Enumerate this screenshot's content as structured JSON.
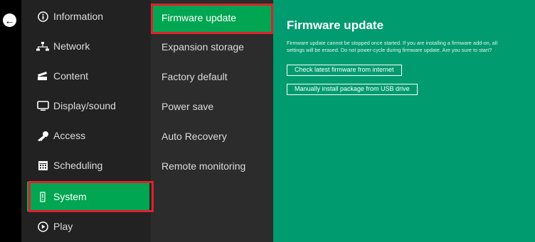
{
  "back_button": {
    "label": "back",
    "icon": "arrow-left-circle-icon"
  },
  "menu": {
    "items": [
      {
        "label": "Information",
        "icon": "info-icon"
      },
      {
        "label": "Network",
        "icon": "network-icon"
      },
      {
        "label": "Content",
        "icon": "content-icon"
      },
      {
        "label": "Display/sound",
        "icon": "display-icon"
      },
      {
        "label": "Access",
        "icon": "key-icon"
      },
      {
        "label": "Scheduling",
        "icon": "calendar-icon"
      },
      {
        "label": "System",
        "icon": "system-icon",
        "selected": true
      },
      {
        "label": "Play",
        "icon": "play-icon"
      }
    ]
  },
  "submenu": {
    "items": [
      {
        "label": "Firmware update",
        "selected": true
      },
      {
        "label": "Expansion storage"
      },
      {
        "label": "Factory default"
      },
      {
        "label": "Power save"
      },
      {
        "label": "Auto Recovery"
      },
      {
        "label": "Remote monitoring"
      }
    ]
  },
  "panel": {
    "title": "Firmware update",
    "description_line1": "Firmware update cannot be stopped once started. If you are installing a firmware add-on, all",
    "description_line2": "settings will be erased. Do not power-cycle during firmware update. Are you sure to start?",
    "check_button": "Check latest firmware from internet",
    "usb_button": "Manually install package from USB drive"
  },
  "colors": {
    "accent_green": "#00a651",
    "panel_green": "#009b6f",
    "highlight_red": "#e0202e",
    "menu_bg": "#222222",
    "submenu_bg": "#2c2c2c"
  }
}
